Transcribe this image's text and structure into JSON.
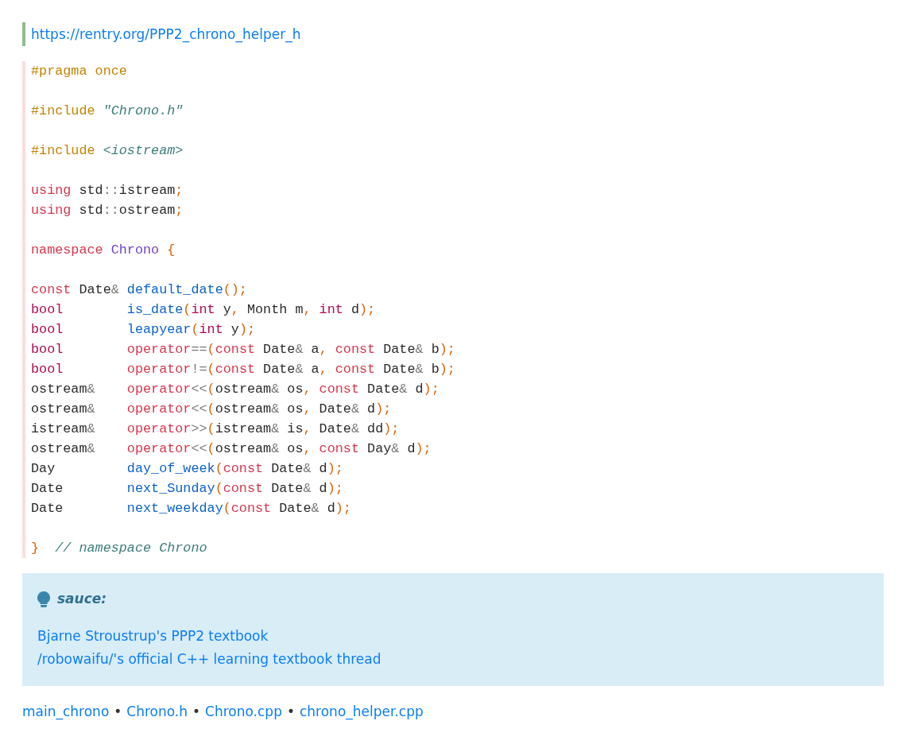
{
  "source_link": "https://rentry.org/PPP2_chrono_helper_h",
  "code_blocks": [
    [
      [
        {
          "kind": "pp",
          "text": "#pragma once"
        }
      ]
    ],
    [
      [
        {
          "kind": "pp",
          "text": "#include"
        },
        {
          "kind": "str",
          "text": " \"Chrono.h\""
        }
      ]
    ],
    [
      [
        {
          "kind": "pp",
          "text": "#include"
        },
        {
          "kind": "str",
          "text": " <iostream>"
        }
      ]
    ],
    [
      [
        {
          "kind": "kw",
          "text": "using"
        },
        {
          "kind": "plain",
          "text": " std"
        },
        {
          "kind": "op",
          "text": "::"
        },
        {
          "kind": "plain",
          "text": "istream"
        },
        {
          "kind": "punct",
          "text": ";"
        }
      ],
      [
        {
          "kind": "kw",
          "text": "using"
        },
        {
          "kind": "plain",
          "text": " std"
        },
        {
          "kind": "op",
          "text": "::"
        },
        {
          "kind": "plain",
          "text": "ostream"
        },
        {
          "kind": "punct",
          "text": ";"
        }
      ]
    ],
    [
      [
        {
          "kind": "kw",
          "text": "namespace"
        },
        {
          "kind": "ns",
          "text": " Chrono"
        },
        {
          "kind": "punct",
          "text": " {"
        }
      ]
    ],
    [
      [
        {
          "kind": "kw",
          "text": "const"
        },
        {
          "kind": "plain",
          "text": " Date"
        },
        {
          "kind": "op",
          "text": "&"
        },
        {
          "kind": "fn",
          "text": " default_date"
        },
        {
          "kind": "punct",
          "text": "();"
        }
      ],
      [
        {
          "kind": "type",
          "text": "bool"
        },
        {
          "kind": "fn",
          "text": "        is_date"
        },
        {
          "kind": "punct",
          "text": "("
        },
        {
          "kind": "type",
          "text": "int"
        },
        {
          "kind": "plain",
          "text": " y"
        },
        {
          "kind": "punct",
          "text": ","
        },
        {
          "kind": "plain",
          "text": " Month m"
        },
        {
          "kind": "punct",
          "text": ","
        },
        {
          "kind": "type",
          "text": " int"
        },
        {
          "kind": "plain",
          "text": " d"
        },
        {
          "kind": "punct",
          "text": ");"
        }
      ],
      [
        {
          "kind": "type",
          "text": "bool"
        },
        {
          "kind": "fn",
          "text": "        leapyear"
        },
        {
          "kind": "punct",
          "text": "("
        },
        {
          "kind": "type",
          "text": "int"
        },
        {
          "kind": "plain",
          "text": " y"
        },
        {
          "kind": "punct",
          "text": ");"
        }
      ],
      [
        {
          "kind": "type",
          "text": "bool"
        },
        {
          "kind": "kw",
          "text": "        operator"
        },
        {
          "kind": "op",
          "text": "=="
        },
        {
          "kind": "punct",
          "text": "("
        },
        {
          "kind": "kw",
          "text": "const"
        },
        {
          "kind": "plain",
          "text": " Date"
        },
        {
          "kind": "op",
          "text": "&"
        },
        {
          "kind": "plain",
          "text": " a"
        },
        {
          "kind": "punct",
          "text": ","
        },
        {
          "kind": "kw",
          "text": " const"
        },
        {
          "kind": "plain",
          "text": " Date"
        },
        {
          "kind": "op",
          "text": "&"
        },
        {
          "kind": "plain",
          "text": " b"
        },
        {
          "kind": "punct",
          "text": ");"
        }
      ],
      [
        {
          "kind": "type",
          "text": "bool"
        },
        {
          "kind": "kw",
          "text": "        operator"
        },
        {
          "kind": "op",
          "text": "!="
        },
        {
          "kind": "punct",
          "text": "("
        },
        {
          "kind": "kw",
          "text": "const"
        },
        {
          "kind": "plain",
          "text": " Date"
        },
        {
          "kind": "op",
          "text": "&"
        },
        {
          "kind": "plain",
          "text": " a"
        },
        {
          "kind": "punct",
          "text": ","
        },
        {
          "kind": "kw",
          "text": " const"
        },
        {
          "kind": "plain",
          "text": " Date"
        },
        {
          "kind": "op",
          "text": "&"
        },
        {
          "kind": "plain",
          "text": " b"
        },
        {
          "kind": "punct",
          "text": ");"
        }
      ],
      [
        {
          "kind": "plain",
          "text": "ostream"
        },
        {
          "kind": "op",
          "text": "&"
        },
        {
          "kind": "kw",
          "text": "    operator"
        },
        {
          "kind": "op",
          "text": "<<"
        },
        {
          "kind": "punct",
          "text": "("
        },
        {
          "kind": "plain",
          "text": "ostream"
        },
        {
          "kind": "op",
          "text": "&"
        },
        {
          "kind": "plain",
          "text": " os"
        },
        {
          "kind": "punct",
          "text": ","
        },
        {
          "kind": "kw",
          "text": " const"
        },
        {
          "kind": "plain",
          "text": " Date"
        },
        {
          "kind": "op",
          "text": "&"
        },
        {
          "kind": "plain",
          "text": " d"
        },
        {
          "kind": "punct",
          "text": ");"
        }
      ],
      [
        {
          "kind": "plain",
          "text": "ostream"
        },
        {
          "kind": "op",
          "text": "&"
        },
        {
          "kind": "kw",
          "text": "    operator"
        },
        {
          "kind": "op",
          "text": "<<"
        },
        {
          "kind": "punct",
          "text": "("
        },
        {
          "kind": "plain",
          "text": "ostream"
        },
        {
          "kind": "op",
          "text": "&"
        },
        {
          "kind": "plain",
          "text": " os"
        },
        {
          "kind": "punct",
          "text": ","
        },
        {
          "kind": "plain",
          "text": " Date"
        },
        {
          "kind": "op",
          "text": "&"
        },
        {
          "kind": "plain",
          "text": " d"
        },
        {
          "kind": "punct",
          "text": ");"
        }
      ],
      [
        {
          "kind": "plain",
          "text": "istream"
        },
        {
          "kind": "op",
          "text": "&"
        },
        {
          "kind": "kw",
          "text": "    operator"
        },
        {
          "kind": "op",
          "text": ">>"
        },
        {
          "kind": "punct",
          "text": "("
        },
        {
          "kind": "plain",
          "text": "istream"
        },
        {
          "kind": "op",
          "text": "&"
        },
        {
          "kind": "plain",
          "text": " is"
        },
        {
          "kind": "punct",
          "text": ","
        },
        {
          "kind": "plain",
          "text": " Date"
        },
        {
          "kind": "op",
          "text": "&"
        },
        {
          "kind": "plain",
          "text": " dd"
        },
        {
          "kind": "punct",
          "text": ");"
        }
      ],
      [
        {
          "kind": "plain",
          "text": "ostream"
        },
        {
          "kind": "op",
          "text": "&"
        },
        {
          "kind": "kw",
          "text": "    operator"
        },
        {
          "kind": "op",
          "text": "<<"
        },
        {
          "kind": "punct",
          "text": "("
        },
        {
          "kind": "plain",
          "text": "ostream"
        },
        {
          "kind": "op",
          "text": "&"
        },
        {
          "kind": "plain",
          "text": " os"
        },
        {
          "kind": "punct",
          "text": ","
        },
        {
          "kind": "kw",
          "text": " const"
        },
        {
          "kind": "plain",
          "text": " Day"
        },
        {
          "kind": "op",
          "text": "&"
        },
        {
          "kind": "plain",
          "text": " d"
        },
        {
          "kind": "punct",
          "text": ");"
        }
      ],
      [
        {
          "kind": "plain",
          "text": "Day"
        },
        {
          "kind": "fn",
          "text": "         day_of_week"
        },
        {
          "kind": "punct",
          "text": "("
        },
        {
          "kind": "kw",
          "text": "const"
        },
        {
          "kind": "plain",
          "text": " Date"
        },
        {
          "kind": "op",
          "text": "&"
        },
        {
          "kind": "plain",
          "text": " d"
        },
        {
          "kind": "punct",
          "text": ");"
        }
      ],
      [
        {
          "kind": "plain",
          "text": "Date"
        },
        {
          "kind": "fn",
          "text": "        next_Sunday"
        },
        {
          "kind": "punct",
          "text": "("
        },
        {
          "kind": "kw",
          "text": "const"
        },
        {
          "kind": "plain",
          "text": " Date"
        },
        {
          "kind": "op",
          "text": "&"
        },
        {
          "kind": "plain",
          "text": " d"
        },
        {
          "kind": "punct",
          "text": ");"
        }
      ],
      [
        {
          "kind": "plain",
          "text": "Date"
        },
        {
          "kind": "fn",
          "text": "        next_weekday"
        },
        {
          "kind": "punct",
          "text": "("
        },
        {
          "kind": "kw",
          "text": "const"
        },
        {
          "kind": "plain",
          "text": " Date"
        },
        {
          "kind": "op",
          "text": "&"
        },
        {
          "kind": "plain",
          "text": " d"
        },
        {
          "kind": "punct",
          "text": ");"
        }
      ]
    ],
    [
      [
        {
          "kind": "punct",
          "text": "}"
        },
        {
          "kind": "cmt",
          "text": "  // namespace Chrono"
        }
      ]
    ]
  ],
  "callout": {
    "title": "sauce:",
    "links": [
      "Bjarne Stroustrup's PPP2 textbook",
      "/robowaifu/'s official C++ learning textbook thread"
    ]
  },
  "footer": [
    {
      "kind": "link",
      "text": "main_chrono"
    },
    {
      "kind": "separator",
      "text": "•"
    },
    {
      "kind": "link",
      "text": "Chrono.h"
    },
    {
      "kind": "separator",
      "text": "•"
    },
    {
      "kind": "link",
      "text": "Chrono.cpp"
    },
    {
      "kind": "separator",
      "text": "•"
    },
    {
      "kind": "link",
      "text": "chrono_helper.cpp"
    }
  ]
}
